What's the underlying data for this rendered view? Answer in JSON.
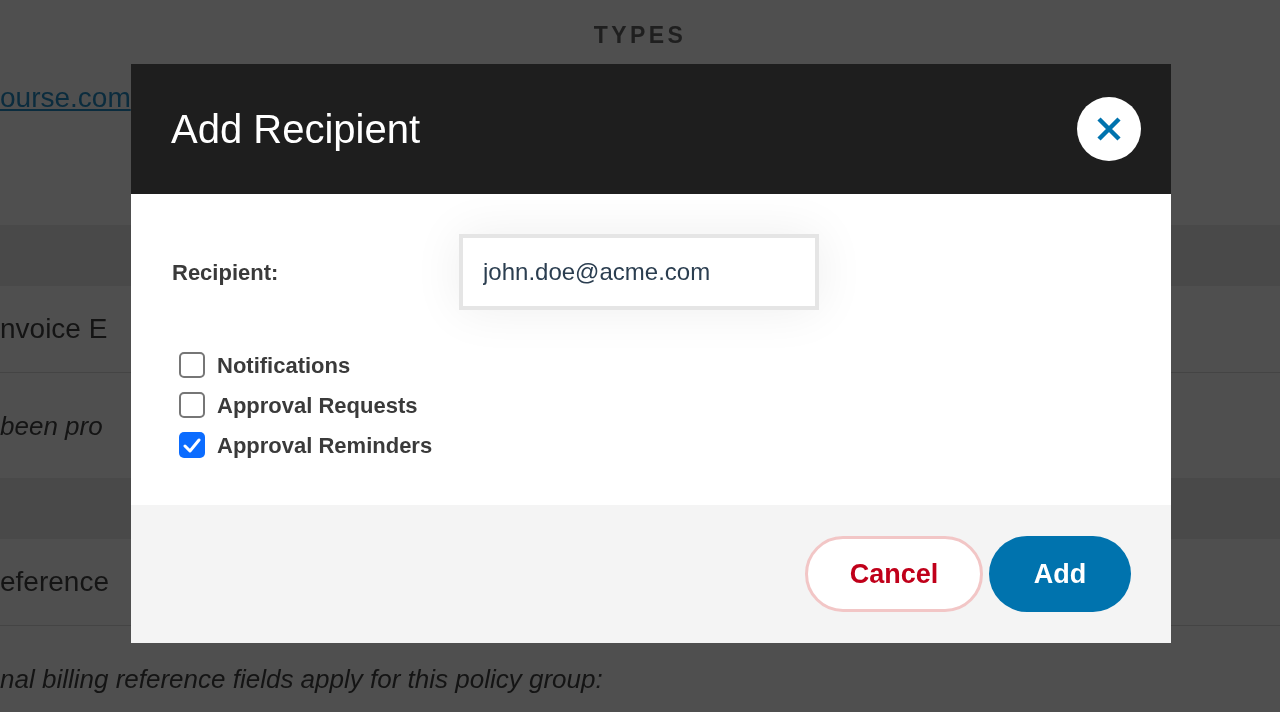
{
  "background": {
    "heading": "TYPES",
    "link": "ourse.com",
    "sections": [
      {
        "title": "nvoice E",
        "note": "been pro"
      },
      {
        "title": "eference",
        "note": "nal billing reference fields apply for this policy group:"
      }
    ]
  },
  "dialog": {
    "title": "Add Recipient",
    "recipient": {
      "label": "Recipient:",
      "value": "john.doe@acme.com"
    },
    "options": [
      {
        "label": "Notifications",
        "checked": false
      },
      {
        "label": "Approval Requests",
        "checked": false
      },
      {
        "label": "Approval Reminders",
        "checked": true
      }
    ],
    "buttons": [
      {
        "kind": "secondary",
        "label": "Cancel"
      },
      {
        "kind": "primary",
        "label": "Add"
      }
    ]
  }
}
